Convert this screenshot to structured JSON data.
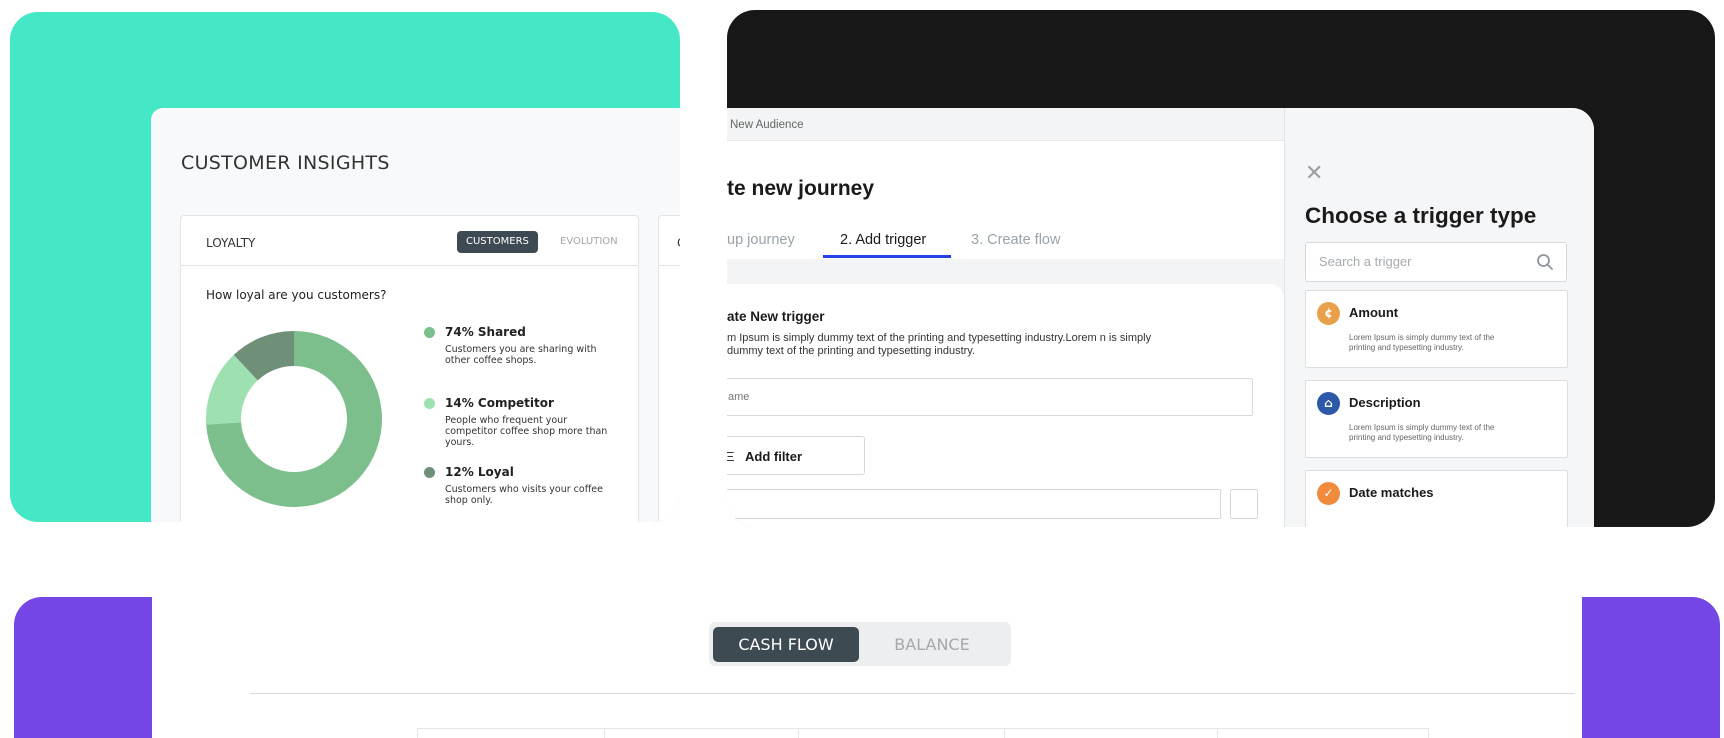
{
  "insights": {
    "title": "CUSTOMER INSIGHTS",
    "loyalty_label": "LOYALTY",
    "tab_customers": "CUSTOMERS",
    "tab_evolution": "EVOLUTION",
    "question": "How loyal are you customers?",
    "second_card_label": "C",
    "chart_data": {
      "type": "pie",
      "values": [
        74,
        14,
        12
      ],
      "categories": [
        "Shared",
        "Competitor",
        "Loyal"
      ],
      "colors": [
        "#7dbf8c",
        "#9fe0b0",
        "#6f8f79"
      ]
    },
    "legend": [
      {
        "title": "74% Shared",
        "desc": "Customers you are sharing with other coffee shops.",
        "color": "#7dbf8c"
      },
      {
        "title": "14% Competitor",
        "desc": "People who frequent your competitor coffee shop more than yours.",
        "color": "#9fe0b0"
      },
      {
        "title": "12% Loyal",
        "desc": "Customers who visits your coffee shop only.",
        "color": "#6f8f79"
      }
    ]
  },
  "journey": {
    "crumb": "New Audience",
    "title": "te new journey",
    "steps": [
      "up journey",
      "2. Add trigger",
      "3. Create flow"
    ],
    "form_title": "ate New trigger",
    "form_desc": "m Ipsum is simply dummy text of the printing and typesetting industry.Lorem n is simply dummy text of the printing and typesetting industry.",
    "name_placeholder": "ame",
    "add_filter": "Add filter"
  },
  "trigger": {
    "title": "Choose a trigger type",
    "search_placeholder": "Search a trigger",
    "items": [
      {
        "name": "Amount",
        "desc": "Lorem Ipsum is simply dummy text of the printing and typesetting industry.",
        "icon": "coin-icon",
        "color": "#e8a14a"
      },
      {
        "name": "Description",
        "desc": "Lorem Ipsum is simply dummy text of the printing and typesetting industry.",
        "icon": "bank-icon",
        "color": "#2e58a8"
      },
      {
        "name": "Date matches",
        "desc": "",
        "icon": "calendar-check-icon",
        "color": "#f08a3c"
      }
    ]
  },
  "cashflow": {
    "toggle_active": "CASH FLOW",
    "toggle_inactive": "BALANCE"
  },
  "colors": {
    "teal": "#45e8c6",
    "black": "#181818",
    "purple": "#7446e6",
    "accent_blue": "#2242e5"
  }
}
